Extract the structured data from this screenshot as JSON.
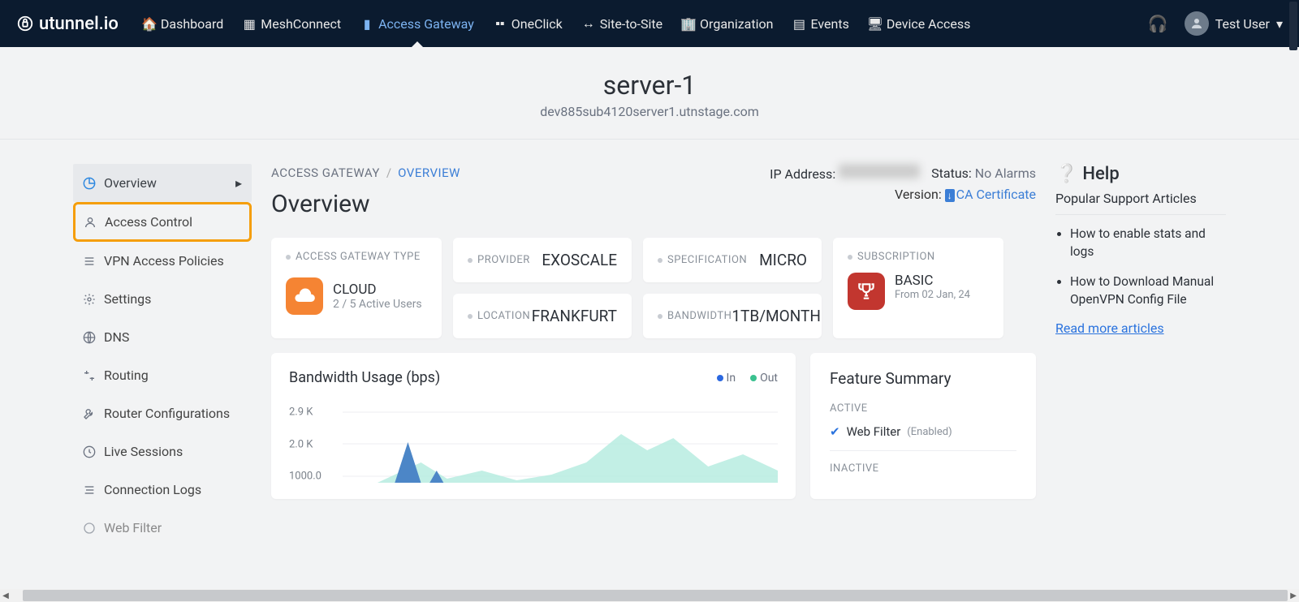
{
  "brand": "utunnel.io",
  "nav": [
    {
      "label": "Dashboard"
    },
    {
      "label": "MeshConnect"
    },
    {
      "label": "Access Gateway",
      "active": true
    },
    {
      "label": "OneClick"
    },
    {
      "label": "Site-to-Site"
    },
    {
      "label": "Organization"
    },
    {
      "label": "Events"
    },
    {
      "label": "Device Access"
    }
  ],
  "user_name": "Test User",
  "server": {
    "title": "server-1",
    "host": "dev885sub4120server1.utnstage.com"
  },
  "sidebar": [
    {
      "label": "Overview",
      "active": true
    },
    {
      "label": "Access Control",
      "highlighted": true
    },
    {
      "label": "VPN Access Policies"
    },
    {
      "label": "Settings"
    },
    {
      "label": "DNS"
    },
    {
      "label": "Routing"
    },
    {
      "label": "Router Configurations"
    },
    {
      "label": "Live Sessions"
    },
    {
      "label": "Connection Logs"
    },
    {
      "label": "Web Filter"
    }
  ],
  "breadcrumb": {
    "root": "ACCESS GATEWAY",
    "sep": "/",
    "current": "OVERVIEW"
  },
  "page_title": "Overview",
  "status_row": {
    "ip_label": "IP Address:",
    "status_label": "Status:",
    "status_value": "No Alarms",
    "version_label": "Version:",
    "ca_text": "CA Certificate"
  },
  "cards": {
    "type_label": "ACCESS GATEWAY TYPE",
    "cloud_label": "CLOUD",
    "cloud_users": "2 / 5 Active Users",
    "provider_label": "PROVIDER",
    "provider_value": "EXOSCALE",
    "spec_label": "SPECIFICATION",
    "spec_value": "MICRO",
    "location_label": "LOCATION",
    "location_value": "FRANKFURT",
    "bandwidth_label": "BANDWIDTH",
    "bandwidth_value": "1TB/MONTH",
    "sub_label": "SUBSCRIPTION",
    "plan": "BASIC",
    "from": "From 02 Jan, 24"
  },
  "bandwidth": {
    "title": "Bandwidth Usage (bps)",
    "legend_in": "In",
    "legend_out": "Out"
  },
  "chart_data": {
    "type": "area",
    "ylabel": "bps",
    "yticks": [
      "2.9 K",
      "2.0 K",
      "1000.0"
    ],
    "ylim": [
      0,
      2900
    ],
    "series": [
      {
        "name": "In",
        "color": "#2b68e0"
      },
      {
        "name": "Out",
        "color": "#3ac18f"
      }
    ]
  },
  "feature_summary": {
    "title": "Feature Summary",
    "active_label": "ACTIVE",
    "inactive_label": "INACTIVE",
    "item_name": "Web Filter",
    "item_state": "(Enabled)"
  },
  "help": {
    "title": "Help",
    "subtitle": "Popular Support Articles",
    "items": [
      "How to enable stats and logs",
      "How to Download Manual OpenVPN Config File"
    ],
    "read_more": "Read more articles"
  }
}
